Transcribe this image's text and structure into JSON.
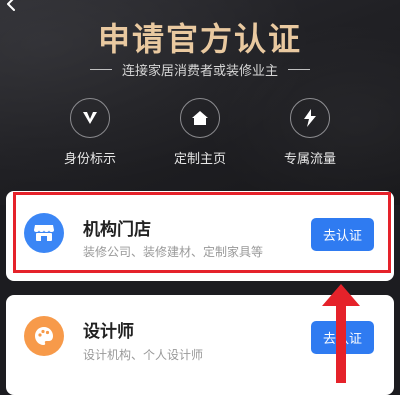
{
  "hero": {
    "title": "申请官方认证",
    "subtitle": "连接家居消费者或装修业主"
  },
  "features": [
    {
      "icon": "v-badge-icon",
      "label": "身份标示"
    },
    {
      "icon": "home-icon",
      "label": "定制主页"
    },
    {
      "icon": "lightning-icon",
      "label": "专属流量"
    }
  ],
  "cards": [
    {
      "icon": "storefront-icon",
      "icon_color": "#3b86f5",
      "title": "机构门店",
      "desc": "装修公司、装修建材、定制家具等",
      "button": "去认证"
    },
    {
      "icon": "palette-icon",
      "icon_color": "#f79a4a",
      "title": "设计师",
      "desc": "设计机构、个人设计师",
      "button": "去认证"
    }
  ],
  "colors": {
    "accent": "#2f7bf1",
    "title_gold": "#e9c9a0",
    "annotation_red": "#e5222a"
  }
}
